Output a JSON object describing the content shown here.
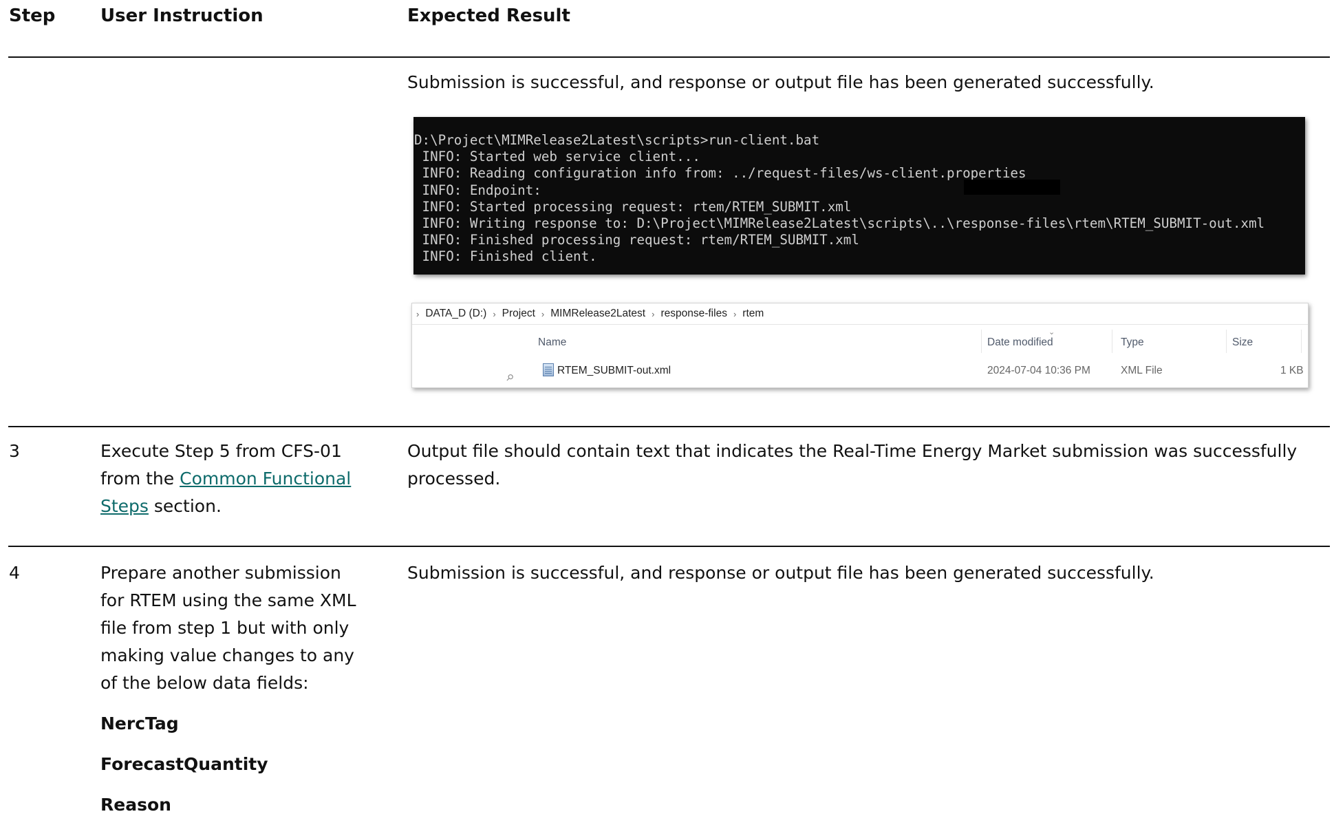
{
  "table": {
    "headers": {
      "step": "Step",
      "instruction": "User Instruction",
      "expected": "Expected Result"
    },
    "rows": [
      {
        "expected": "Submission is successful, and response or output file has been generated successfully."
      },
      {
        "step": "3",
        "instruction_lines": [
          "Execute Step 5 from CFS-01",
          "from the ",
          " section."
        ],
        "instruction_link": [
          "Common Functional",
          "Steps"
        ],
        "expected_lines": [
          "Output file should contain text that indicates the Real-Time Energy Market submission was successfully",
          "processed."
        ]
      },
      {
        "step": "4",
        "instruction_lines": [
          "Prepare another submission",
          "for RTEM using the same XML",
          "file from step 1 but with only",
          "making value changes to any",
          "of the below data fields:"
        ],
        "fields": [
          "NercTag",
          "ForecastQuantity",
          "Reason"
        ],
        "expected": "Submission is successful, and response or output file has been generated successfully."
      }
    ]
  },
  "console": {
    "lines": [
      "D:\\Project\\MIMRelease2Latest\\scripts>run-client.bat",
      " INFO: Started web service client...",
      " INFO: Reading configuration info from: ../request-files/ws-client.properties",
      " INFO: Endpoint:",
      " INFO: Started processing request: rtem/RTEM_SUBMIT.xml",
      " INFO: Writing response to: D:\\Project\\MIMRelease2Latest\\scripts\\..\\response-files\\rtem\\RTEM_SUBMIT-out.xml",
      " INFO: Finished processing request: rtem/RTEM_SUBMIT.xml",
      " INFO: Finished client."
    ]
  },
  "explorer": {
    "breadcrumb": [
      "DATA_D (D:)",
      "Project",
      "MIMRelease2Latest",
      "response-files",
      "rtem"
    ],
    "columns": {
      "name": "Name",
      "date": "Date modified",
      "type": "Type",
      "size": "Size"
    },
    "file": {
      "name": "RTEM_SUBMIT-out.xml",
      "date": "2024-07-04 10:36 PM",
      "type": "XML File",
      "size": "1 KB"
    }
  }
}
